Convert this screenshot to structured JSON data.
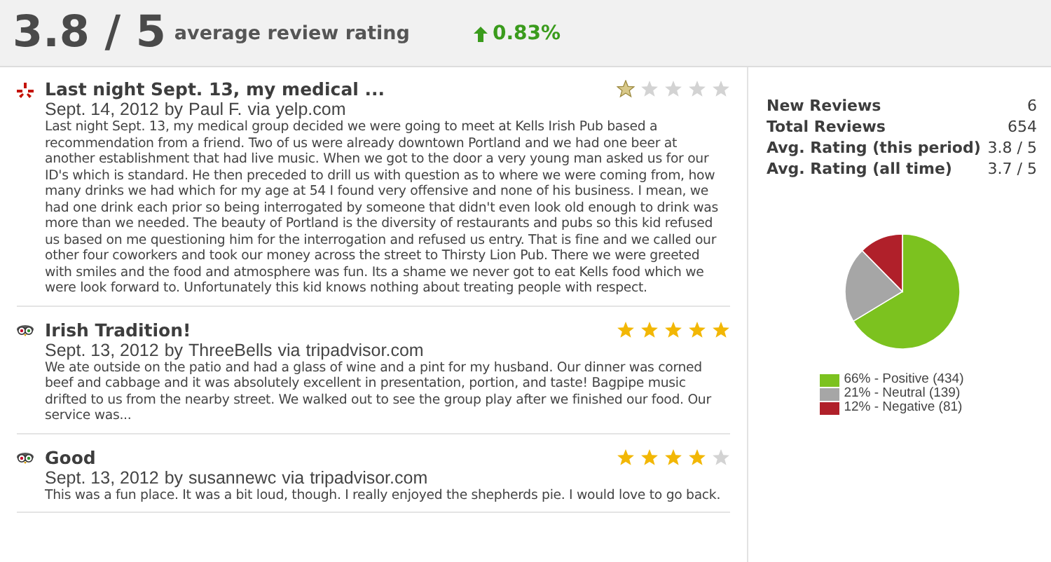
{
  "header": {
    "score": "3.8 / 5",
    "label": "average review rating",
    "change": "0.83%"
  },
  "reviews": [
    {
      "kind": "yelp",
      "title": "Last night Sept. 13, my medical ...",
      "date": "Sept. 14, 2012",
      "by": "by",
      "author": "Paul F.",
      "via": "via",
      "site": "yelp.com",
      "stars": 1,
      "text": "Last night Sept. 13, my medical group decided we were going to meet at Kells Irish Pub based a recommendation from a friend. Two of us were already downtown Portland and we had one beer at another establishment that had live music. When we got to the door a very young man asked us for our ID's which is standard. He then preceded to drill us with question as to where we were coming from, how many drinks we had which for my age at 54 I found very offensive and none of his business. I mean, we had one drink each prior so being interrogated by someone that didn't even look old enough to drink was more than we needed. The beauty of Portland is the diversity of restaurants and pubs so this kid refused us based on me questioning him for the interrogation and refused us entry. That is fine and we called our other four coworkers and took our money across the street to Thirsty Lion Pub. There we were greeted with smiles and the food and atmosphere was fun. Its a shame we never got to eat Kells food which we were look forward to. Unfortunately this kid knows nothing about treating people with respect."
    },
    {
      "kind": "tripadvisor",
      "title": "Irish Tradition!",
      "date": "Sept. 13, 2012",
      "by": "by",
      "author": "ThreeBells",
      "via": "via",
      "site": "tripadvisor.com",
      "stars": 5,
      "text": "We ate outside on the patio and had a glass of wine and a pint for my husband. Our dinner was corned beef and cabbage and it was absolutely excellent in presentation, portion, and taste! Bagpipe music drifted to us from the nearby street. We walked out to see the group play after we finished our food. Our service was..."
    },
    {
      "kind": "tripadvisor",
      "title": "Good",
      "date": "Sept. 13, 2012",
      "by": "by",
      "author": "susannewc",
      "via": "via",
      "site": "tripadvisor.com",
      "stars": 4,
      "text": "This was a fun place. It was a bit loud, though. I really enjoyed the shepherds pie. I would love to go back."
    }
  ],
  "stats": [
    {
      "label": "New Reviews",
      "value": "6"
    },
    {
      "label": "Total Reviews",
      "value": "654"
    },
    {
      "label": "Avg. Rating (this period)",
      "value": "3.8 / 5"
    },
    {
      "label": "Avg. Rating (all time)",
      "value": "3.7 / 5"
    }
  ],
  "sentiment": {
    "chart_data": {
      "type": "pie",
      "categories": [
        "66% - Positive (434)",
        "21% - Neutral (139)",
        "12% - Negative (81)"
      ],
      "series": [
        {
          "values": [
            434,
            139,
            81
          ]
        }
      ],
      "legend": true,
      "colors": [
        "#7cc21f",
        "#a6a6a6",
        "#b0202a"
      ]
    }
  }
}
